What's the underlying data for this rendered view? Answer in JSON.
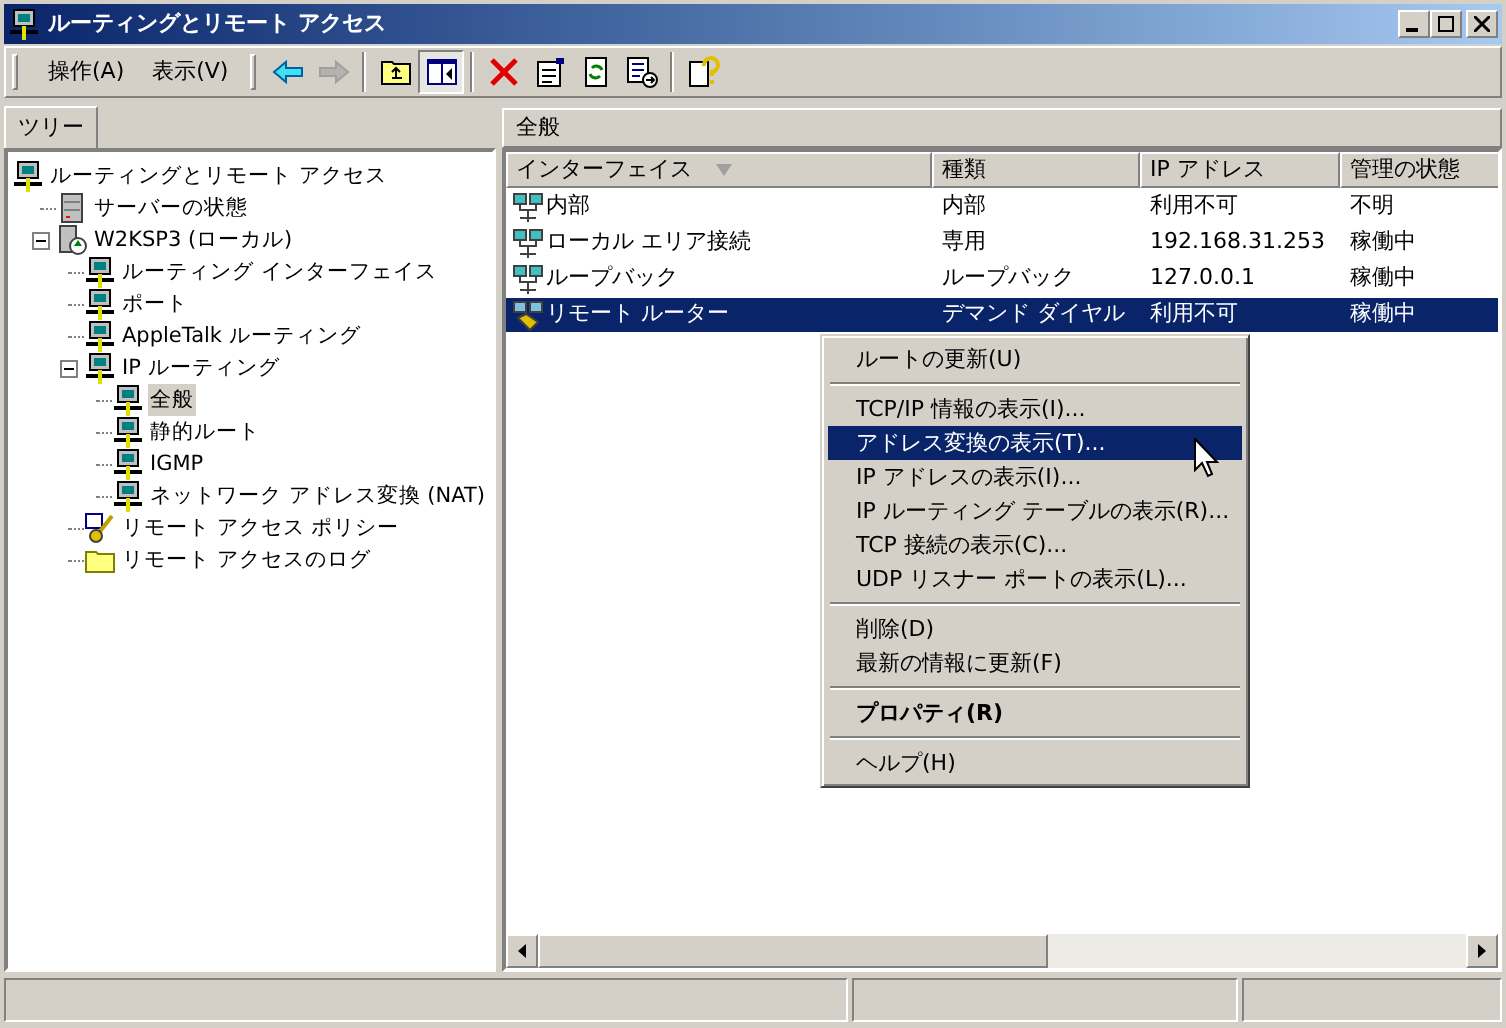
{
  "window": {
    "title": "ルーティングとリモート アクセス"
  },
  "menus": [
    {
      "label": "操作(A)"
    },
    {
      "label": "表示(V)"
    }
  ],
  "toolbar": [
    {
      "kind": "back",
      "disabled": false,
      "pressed": false
    },
    {
      "kind": "forward",
      "disabled": true,
      "pressed": false
    },
    {
      "kind": "sep"
    },
    {
      "kind": "up",
      "disabled": false,
      "pressed": false
    },
    {
      "kind": "tree",
      "disabled": false,
      "pressed": true
    },
    {
      "kind": "sep"
    },
    {
      "kind": "delete",
      "disabled": false,
      "pressed": false
    },
    {
      "kind": "properties",
      "disabled": false,
      "pressed": false
    },
    {
      "kind": "refresh",
      "disabled": false,
      "pressed": false
    },
    {
      "kind": "export",
      "disabled": false,
      "pressed": false
    },
    {
      "kind": "sep"
    },
    {
      "kind": "help",
      "disabled": false,
      "pressed": false
    }
  ],
  "tree_tab": {
    "label": "ツリー"
  },
  "tree": [
    {
      "label": "ルーティングとリモート アクセス",
      "kind": "computer",
      "selected": false,
      "children": [
        {
          "label": "サーバーの状態",
          "kind": "server",
          "selected": false
        },
        {
          "label": "W2KSP3 (ローカル)",
          "kind": "local",
          "selected": false,
          "expanded": true,
          "children": [
            {
              "label": "ルーティング インターフェイス",
              "kind": "computer",
              "selected": false
            },
            {
              "label": "ポート",
              "kind": "computer",
              "selected": false
            },
            {
              "label": "AppleTalk ルーティング",
              "kind": "computer",
              "selected": false
            },
            {
              "label": "IP ルーティング",
              "kind": "computer",
              "selected": false,
              "expanded": true,
              "children": [
                {
                  "label": "全般",
                  "kind": "computer",
                  "selected": true
                },
                {
                  "label": "静的ルート",
                  "kind": "computer",
                  "selected": false
                },
                {
                  "label": "IGMP",
                  "kind": "computer",
                  "selected": false
                },
                {
                  "label": "ネットワーク アドレス変換 (NAT)",
                  "kind": "computer",
                  "selected": false
                }
              ]
            },
            {
              "label": "リモート アクセス ポリシー",
              "kind": "policy",
              "selected": false
            },
            {
              "label": "リモート アクセスのログ",
              "kind": "folder",
              "selected": false
            }
          ]
        }
      ]
    }
  ],
  "list": {
    "title": "全般",
    "columns": [
      {
        "label": "インターフェイス",
        "sorted": true
      },
      {
        "label": "種類",
        "sorted": false
      },
      {
        "label": "IP アドレス",
        "sorted": false
      },
      {
        "label": "管理の状態",
        "sorted": false
      }
    ],
    "rows": [
      {
        "kind": "network",
        "selected": false,
        "cells": [
          "内部",
          "内部",
          "利用不可",
          "不明"
        ]
      },
      {
        "kind": "network",
        "selected": false,
        "cells": [
          "ローカル エリア接続",
          "専用",
          "192.168.31.253",
          "稼働中"
        ]
      },
      {
        "kind": "network",
        "selected": false,
        "cells": [
          "ループバック",
          "ループバック",
          "127.0.0.1",
          "稼働中"
        ]
      },
      {
        "kind": "router",
        "selected": true,
        "cells": [
          "リモート ルーター",
          "デマンド ダイヤル",
          "利用不可",
          "稼働中"
        ]
      }
    ]
  },
  "context_menu": [
    {
      "kind": "item",
      "label": "ルートの更新(U)",
      "selected": false,
      "bold": false
    },
    {
      "kind": "separator"
    },
    {
      "kind": "item",
      "label": "TCP/IP 情報の表示(I)...",
      "selected": false,
      "bold": false
    },
    {
      "kind": "item",
      "label": "アドレス変換の表示(T)...",
      "selected": true,
      "bold": false
    },
    {
      "kind": "item",
      "label": "IP アドレスの表示(I)...",
      "selected": false,
      "bold": false
    },
    {
      "kind": "item",
      "label": "IP ルーティング テーブルの表示(R)...",
      "selected": false,
      "bold": false
    },
    {
      "kind": "item",
      "label": "TCP 接続の表示(C)...",
      "selected": false,
      "bold": false
    },
    {
      "kind": "item",
      "label": "UDP リスナー ポートの表示(L)...",
      "selected": false,
      "bold": false
    },
    {
      "kind": "separator"
    },
    {
      "kind": "item",
      "label": "削除(D)",
      "selected": false,
      "bold": false
    },
    {
      "kind": "item",
      "label": "最新の情報に更新(F)",
      "selected": false,
      "bold": false
    },
    {
      "kind": "separator"
    },
    {
      "kind": "item",
      "label": "プロパティ(R)",
      "selected": false,
      "bold": true
    },
    {
      "kind": "separator"
    },
    {
      "kind": "item",
      "label": "ヘルプ(H)",
      "selected": false,
      "bold": false
    }
  ]
}
